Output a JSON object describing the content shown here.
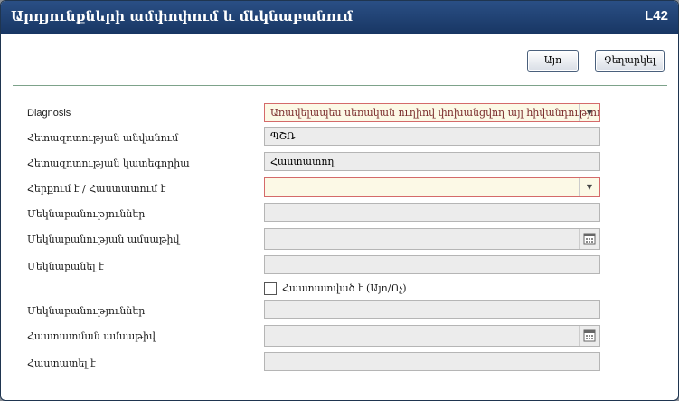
{
  "titlebar": {
    "title": "Արդյունքների ամփոփում և մեկնաբանում",
    "code": "L42"
  },
  "buttons": {
    "ok": "Այո",
    "cancel": "Չեղարկել"
  },
  "form": {
    "diagnosis_label": "Diagnosis",
    "diagnosis_value": "Առավելապես սեռական ուղիով փոխանցվող այլ հիվանդություն",
    "research_name_label": "Հետազոտության անվանում",
    "research_name_value": "ՊՇՌ",
    "research_category_label": "Հետազոտության կատեգորիա",
    "research_category_value": "Հաստատող",
    "refutes_confirms_label": "Հերքում է / Հաստատում է",
    "refutes_confirms_value": "",
    "comments1_label": "Մեկնաբանություններ",
    "comment_date_label": "Մեկնաբանության ամսաթիվ",
    "commented_by_label": "Մեկնաբանել է",
    "confirmed_checkbox_label": "Հաստատված է (Այո/Ոչ)",
    "comments2_label": "Մեկնաբանություններ",
    "confirm_date_label": "Հաստատման ամսաթիվ",
    "confirmed_by_label": "Հաստատել է"
  }
}
